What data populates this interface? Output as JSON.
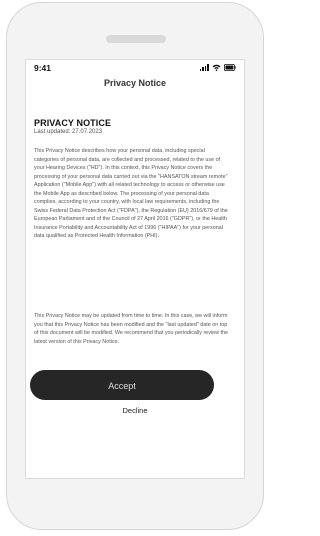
{
  "status_bar": {
    "time": "9:41",
    "icons": [
      "signal-icon",
      "wifi-icon",
      "battery-icon"
    ]
  },
  "header": {
    "title": "Privacy Notice"
  },
  "notice": {
    "heading": "PRIVACY NOTICE",
    "last_updated": "Last updated: 27.07.2023",
    "paragraph_1": "This Privacy Notice describes how your personal data, including special categories of personal data, are collected and processed, related to the use of your Hearing Devices (\"HD\"). In this context, this Privacy Notice covers the processing of your personal data carried out via the \"HANSATON stream remote\" Application (\"Mobile App\") with all related technology to access or otherwise use the Mobile App as described below. The processing of your personal data complies, according to your country, with local law requirements, including the Swiss Federal Data Protection Act (\"FDPA\"), the Regulation (EU) 2016/679 of the European Parliament and of the Council of 27 April 2016 (\"GDPR\"), or the Health Insurance Portability and Accountability Act of 1996 (\"HIPAA\") for your personal data qualified as Protected Health Information (PHI).",
    "paragraph_2": "This Privacy Notice may be updated from time to time. In this case, we will inform you that this Privacy Notice has been modified and the \"last updated\" date on top of this document will be modified. We recommend that you periodically review the latest version of this Privacy Notice."
  },
  "actions": {
    "accept_label": "Accept",
    "decline_label": "Decline"
  },
  "colors": {
    "accept_button_bg": "#262626",
    "accept_button_text": "#dcdcdc",
    "device_frame": "#f3f3f3",
    "body_text": "#555555"
  }
}
